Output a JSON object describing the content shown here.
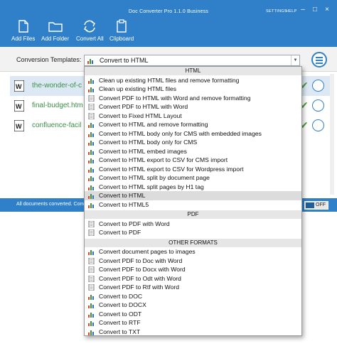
{
  "app": {
    "title": "Doc Converter Pro 1.1.0 Business",
    "settings_label": "SETTINGS",
    "help_label": "HELP",
    "window_controls": {
      "minimize": "–",
      "maximize": "□",
      "close": "×"
    }
  },
  "toolbar": {
    "add_files": "Add Files",
    "add_folder": "Add Folder",
    "convert_all": "Convert All",
    "clipboard": "Clipboard"
  },
  "templates": {
    "label": "Conversion Templates:",
    "selected": "Convert to HTML"
  },
  "files": [
    {
      "name": "the-wonder-of-c",
      "status_icon": "check-icon"
    },
    {
      "name": "final-budget.htm",
      "status_icon": "check-icon"
    },
    {
      "name": "confluence-facil",
      "status_icon": "check-icon"
    }
  ],
  "status": {
    "text": "All documents converted. Conve",
    "toggle_label": "OFF"
  },
  "dropdown": {
    "html_header": "HTML",
    "html_items": [
      {
        "label": "Clean up existing HTML files and remove formatting",
        "icon": "chart-icon"
      },
      {
        "label": "Clean up existing HTML files",
        "icon": "chart-icon"
      },
      {
        "label": "Convert PDF to HTML with Word and remove formatting",
        "icon": "doc-icon"
      },
      {
        "label": "Convert PDF to HTML with Word",
        "icon": "doc-icon"
      },
      {
        "label": "Convert to Fixed HTML Layout",
        "icon": "doc-icon"
      },
      {
        "label": "Convert to HTML and remove formatting",
        "icon": "chart-icon"
      },
      {
        "label": "Convert to HTML body only for CMS with embedded images",
        "icon": "chart-icon"
      },
      {
        "label": "Convert to HTML body only for CMS",
        "icon": "chart-icon"
      },
      {
        "label": "Convert to HTML embed images",
        "icon": "chart-icon"
      },
      {
        "label": "Convert to HTML export to CSV for CMS import",
        "icon": "chart-icon"
      },
      {
        "label": "Convert to HTML export to CSV for Wordpress import",
        "icon": "chart-icon"
      },
      {
        "label": "Convert to HTML split by document page",
        "icon": "chart-icon"
      },
      {
        "label": "Convert to HTML split pages by H1 tag",
        "icon": "chart-icon"
      },
      {
        "label": "Convert to HTML",
        "icon": "chart-icon"
      },
      {
        "label": "Convert to HTML5",
        "icon": "chart-icon"
      }
    ],
    "pdf_header": "PDF",
    "pdf_items": [
      {
        "label": "Convert to PDF with Word",
        "icon": "doc-icon"
      },
      {
        "label": "Convert to PDF",
        "icon": "doc-icon"
      }
    ],
    "other_header": "OTHER FORMATS",
    "other_items": [
      {
        "label": "Convert document pages to images",
        "icon": "chart-icon"
      },
      {
        "label": "Convert PDF to Doc with Word",
        "icon": "doc-icon"
      },
      {
        "label": "Convert PDF to Docx with Word",
        "icon": "doc-icon"
      },
      {
        "label": "Convert PDF to Odt with Word",
        "icon": "doc-icon"
      },
      {
        "label": "Convert PDF to Rtf with Word",
        "icon": "doc-icon"
      },
      {
        "label": "Convert to DOC",
        "icon": "chart-icon"
      },
      {
        "label": "Convert to DOCX",
        "icon": "chart-icon"
      },
      {
        "label": "Convert to ODT",
        "icon": "chart-icon"
      },
      {
        "label": "Convert to RTF",
        "icon": "chart-icon"
      },
      {
        "label": "Convert to TXT",
        "icon": "chart-icon"
      }
    ],
    "highlighted": "Convert to HTML"
  },
  "colors": {
    "accent": "#2f80c9",
    "file_name": "#3b8f48",
    "check": "#4a9a3c"
  }
}
